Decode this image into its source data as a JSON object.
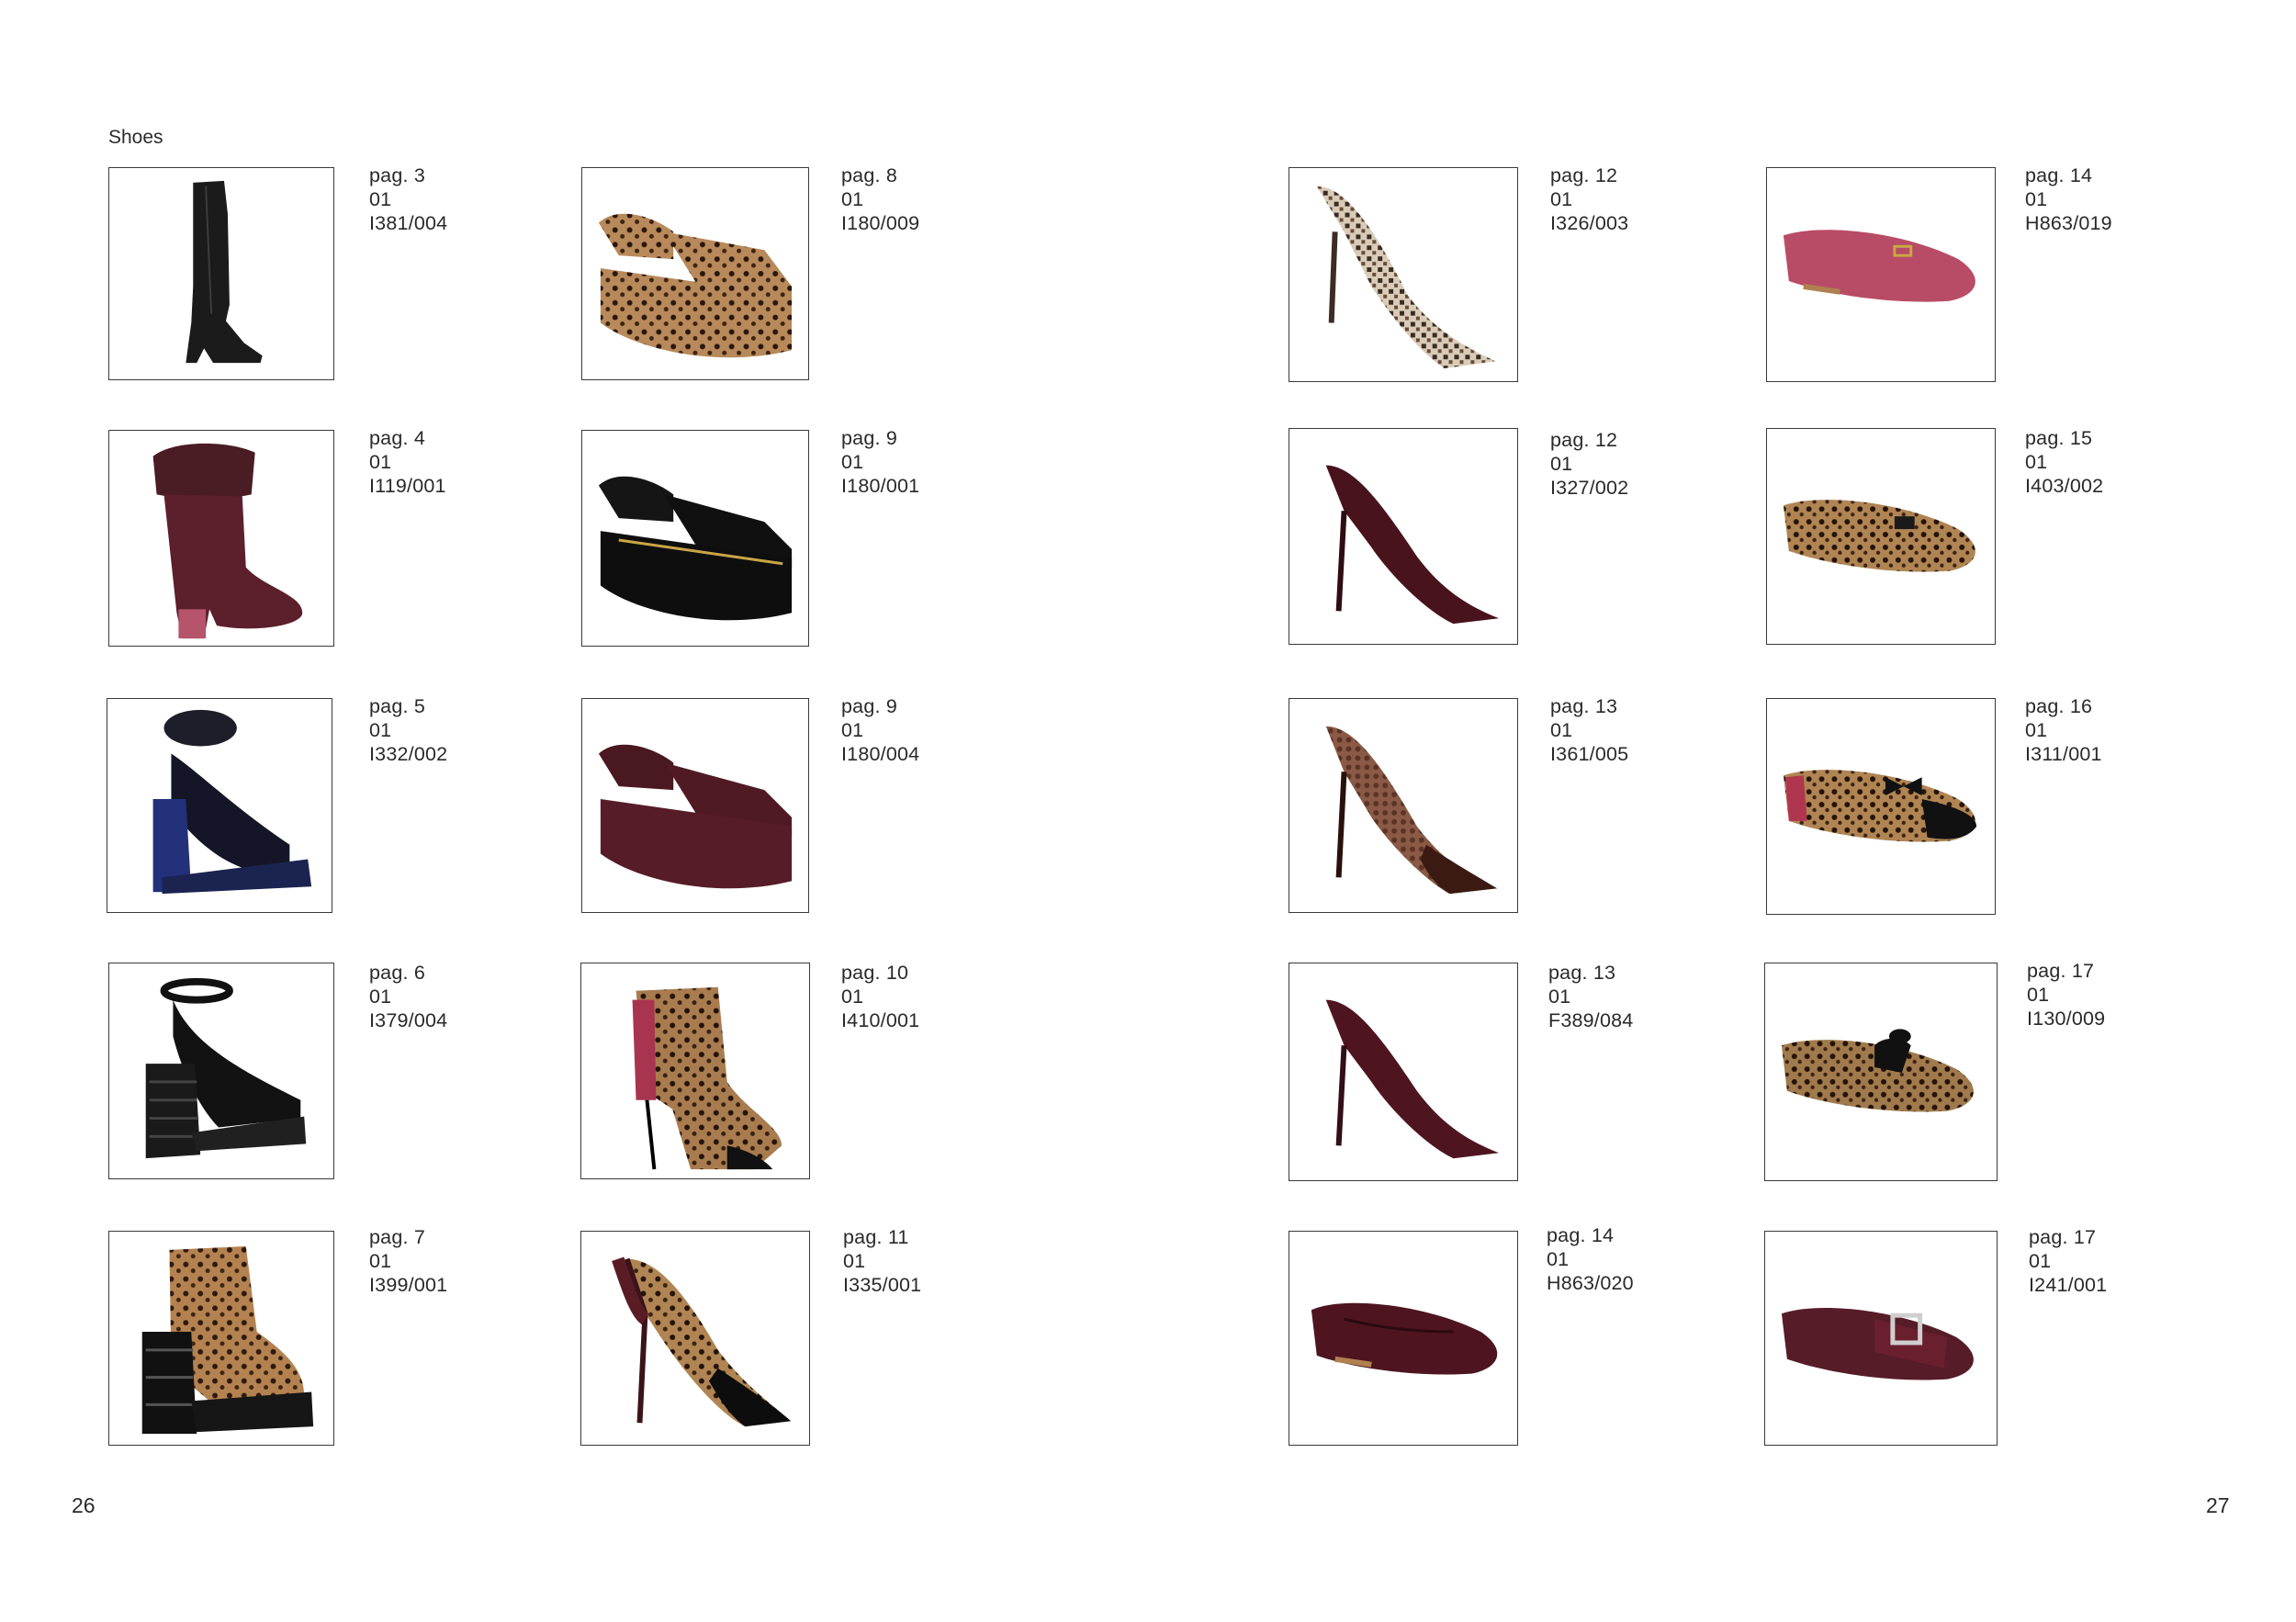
{
  "section_title": "Shoes",
  "page_numbers": {
    "left": "26",
    "right": "27"
  },
  "items": [
    {
      "page": "pag. 3",
      "code": "01 I381/004",
      "icon": "black-knee-boot-icon"
    },
    {
      "page": "pag. 4",
      "code": "01 I119/001",
      "icon": "burgundy-fur-cuff-boot-icon"
    },
    {
      "page": "pag. 5",
      "code": "01 I332/002",
      "icon": "navy-fur-strap-platform-sandal-icon"
    },
    {
      "page": "pag. 6",
      "code": "01 I379/004",
      "icon": "black-ankle-strap-platform-sandal-icon"
    },
    {
      "page": "pag. 7",
      "code": "01 I399/001",
      "icon": "leopard-lace-up-platform-icon"
    },
    {
      "page": "pag. 8",
      "code": "01 I180/009",
      "icon": "leopard-flatform-sandal-icon"
    },
    {
      "page": "pag. 9",
      "code": "01 I180/001",
      "icon": "black-flatform-sandal-icon"
    },
    {
      "page": "pag. 9",
      "code": "01 I180/004",
      "icon": "burgundy-flatform-sandal-icon"
    },
    {
      "page": "pag. 10",
      "code": "01 I410/001",
      "icon": "leopard-peep-toe-bootie-icon"
    },
    {
      "page": "pag. 11",
      "code": "01 I335/001",
      "icon": "leopard-black-toe-pump-icon"
    },
    {
      "page": "pag. 12",
      "code": "01 I326/003",
      "icon": "python-print-pump-icon"
    },
    {
      "page": "pag. 12",
      "code": "01 I327/002",
      "icon": "burgundy-suede-pump-icon"
    },
    {
      "page": "pag. 13",
      "code": "01 I361/005",
      "icon": "bronze-snake-pump-icon"
    },
    {
      "page": "pag. 13",
      "code": "01 F389/084",
      "icon": "burgundy-pump-icon"
    },
    {
      "page": "pag. 14",
      "code": "01 H863/020",
      "icon": "burgundy-ballet-flat-icon"
    },
    {
      "page": "pag. 14",
      "code": "01 H863/019",
      "icon": "pink-ballet-flat-icon"
    },
    {
      "page": "pag. 15",
      "code": "01 I403/002",
      "icon": "leopard-ballet-flat-icon"
    },
    {
      "page": "pag. 16",
      "code": "01 I311/001",
      "icon": "leopard-bow-flat-icon"
    },
    {
      "page": "pag. 17",
      "code": "01 I130/009",
      "icon": "leopard-tassel-loafer-icon"
    },
    {
      "page": "pag. 17",
      "code": "01 I241/001",
      "icon": "burgundy-buckle-loafer-icon"
    }
  ]
}
